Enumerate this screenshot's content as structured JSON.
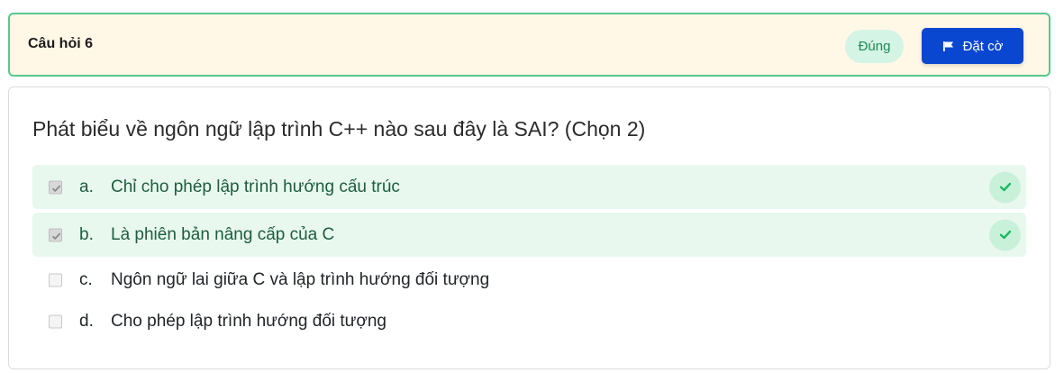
{
  "header": {
    "question_label": "Câu hỏi 6",
    "status": "Đúng",
    "flag_label": "Đặt cờ",
    "flag_icon": "flag-icon"
  },
  "question": {
    "text": "Phát biểu về ngôn ngữ lập trình C++ nào sau đây là SAI? (Chọn 2)",
    "options": [
      {
        "letter": "a.",
        "text": "Chỉ cho phép lập trình hướng cấu trúc",
        "checked": true,
        "correct": true
      },
      {
        "letter": "b.",
        "text": "Là phiên bản nâng cấp của C",
        "checked": true,
        "correct": true
      },
      {
        "letter": "c.",
        "text": "Ngôn ngữ lai giữa C và lập trình hướng đối tượng",
        "checked": false,
        "correct": false
      },
      {
        "letter": "d.",
        "text": "Cho phép lập trình hướng đối tượng",
        "checked": false,
        "correct": false
      }
    ]
  },
  "colors": {
    "header_bg": "#fff8e6",
    "header_border": "#57c98d",
    "correct_bg": "#e8f8ef",
    "accent_blue": "#0a47d1",
    "success_green": "#1fb765"
  }
}
